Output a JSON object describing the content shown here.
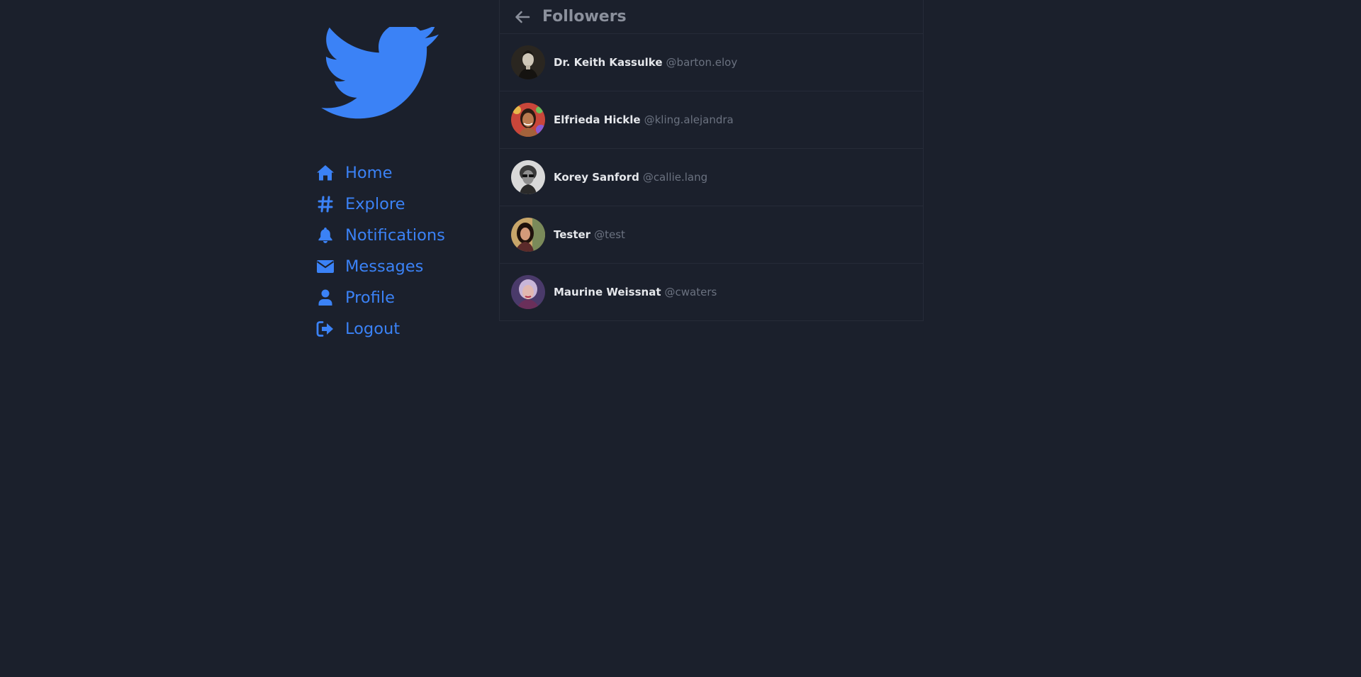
{
  "colors": {
    "background": "#1b202c",
    "accent": "#3b82f6",
    "border": "#262b38",
    "name_text": "#e5e7eb",
    "handle_text": "#6b7280",
    "header_text": "#8b909c"
  },
  "sidebar": {
    "logo_icon": "twitter-bird-icon",
    "items": [
      {
        "label": "Home",
        "icon": "home-icon"
      },
      {
        "label": "Explore",
        "icon": "hashtag-icon"
      },
      {
        "label": "Notifications",
        "icon": "bell-icon"
      },
      {
        "label": "Messages",
        "icon": "envelope-icon"
      },
      {
        "label": "Profile",
        "icon": "user-icon"
      },
      {
        "label": "Logout",
        "icon": "logout-icon"
      }
    ]
  },
  "header": {
    "title": "Followers",
    "back_icon": "arrow-left-icon"
  },
  "followers": [
    {
      "name": "Dr. Keith Kassulke",
      "handle": "@barton.eloy"
    },
    {
      "name": "Elfrieda Hickle",
      "handle": "@kling.alejandra"
    },
    {
      "name": "Korey Sanford",
      "handle": "@callie.lang"
    },
    {
      "name": "Tester",
      "handle": "@test"
    },
    {
      "name": "Maurine Weissnat",
      "handle": "@cwaters"
    }
  ]
}
